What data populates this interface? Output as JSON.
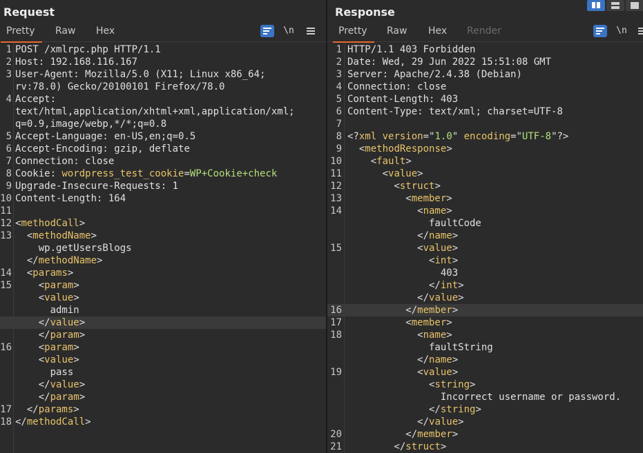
{
  "request": {
    "title": "Request",
    "tabs": [
      {
        "label": "Pretty",
        "active": true
      },
      {
        "label": "Raw",
        "active": false
      },
      {
        "label": "Hex",
        "active": false
      }
    ],
    "newline_label": "\\n",
    "lines": [
      {
        "n": "1",
        "segs": [
          {
            "t": "POST /xmlrpc.php HTTP/1.1",
            "c": "plain"
          }
        ]
      },
      {
        "n": "2",
        "segs": [
          {
            "t": "Host: ",
            "c": "plain"
          },
          {
            "t": "192.168.116.167",
            "c": "text"
          }
        ]
      },
      {
        "n": "3",
        "segs": [
          {
            "t": "User-Agent: ",
            "c": "plain"
          },
          {
            "t": "Mozilla/5.0 (X11; Linux x86_64;",
            "c": "text"
          }
        ]
      },
      {
        "n": "",
        "segs": [
          {
            "t": "rv:78.0) Gecko/20100101 Firefox/78.0",
            "c": "text"
          }
        ]
      },
      {
        "n": "4",
        "segs": [
          {
            "t": "Accept:",
            "c": "plain"
          }
        ]
      },
      {
        "n": "",
        "segs": [
          {
            "t": "text/html,application/xhtml+xml,application/xml;",
            "c": "text"
          }
        ]
      },
      {
        "n": "",
        "segs": [
          {
            "t": "q=0.9,image/webp,*/*;q=0.8",
            "c": "text"
          }
        ]
      },
      {
        "n": "5",
        "segs": [
          {
            "t": "Accept-Language: ",
            "c": "plain"
          },
          {
            "t": "en-US,en;q=0.5",
            "c": "text"
          }
        ]
      },
      {
        "n": "6",
        "segs": [
          {
            "t": "Accept-Encoding: ",
            "c": "plain"
          },
          {
            "t": "gzip, deflate",
            "c": "text"
          }
        ]
      },
      {
        "n": "7",
        "segs": [
          {
            "t": "Connection: ",
            "c": "plain"
          },
          {
            "t": "close",
            "c": "text"
          }
        ]
      },
      {
        "n": "8",
        "segs": [
          {
            "t": "Cookie: ",
            "c": "plain"
          },
          {
            "t": "wordpress_test_cookie",
            "c": "tag"
          },
          {
            "t": "=",
            "c": "plain"
          },
          {
            "t": "WP+Cookie+check",
            "c": "val"
          }
        ]
      },
      {
        "n": "9",
        "segs": [
          {
            "t": "Upgrade-Insecure-Requests: ",
            "c": "plain"
          },
          {
            "t": "1",
            "c": "text"
          }
        ]
      },
      {
        "n": "10",
        "segs": [
          {
            "t": "Content-Length: ",
            "c": "plain"
          },
          {
            "t": "164",
            "c": "text"
          }
        ]
      },
      {
        "n": "11",
        "segs": []
      },
      {
        "n": "12",
        "segs": [
          {
            "t": "<",
            "c": "br"
          },
          {
            "t": "methodCall",
            "c": "tag"
          },
          {
            "t": ">",
            "c": "br"
          }
        ]
      },
      {
        "n": "13",
        "segs": [
          {
            "t": "  <",
            "c": "br"
          },
          {
            "t": "methodName",
            "c": "tag"
          },
          {
            "t": ">",
            "c": "br"
          }
        ]
      },
      {
        "n": "",
        "segs": [
          {
            "t": "    wp.getUsersBlogs",
            "c": "text"
          }
        ]
      },
      {
        "n": "",
        "segs": [
          {
            "t": "  </",
            "c": "br"
          },
          {
            "t": "methodName",
            "c": "tag"
          },
          {
            "t": ">",
            "c": "br"
          }
        ]
      },
      {
        "n": "14",
        "segs": [
          {
            "t": "  <",
            "c": "br"
          },
          {
            "t": "params",
            "c": "tag"
          },
          {
            "t": ">",
            "c": "br"
          }
        ]
      },
      {
        "n": "15",
        "segs": [
          {
            "t": "    <",
            "c": "br"
          },
          {
            "t": "param",
            "c": "tag"
          },
          {
            "t": ">",
            "c": "br"
          }
        ]
      },
      {
        "n": "",
        "segs": [
          {
            "t": "    <",
            "c": "br"
          },
          {
            "t": "value",
            "c": "tag"
          },
          {
            "t": ">",
            "c": "br"
          }
        ]
      },
      {
        "n": "",
        "segs": [
          {
            "t": "      admin",
            "c": "text"
          }
        ]
      },
      {
        "n": "",
        "hl": true,
        "segs": [
          {
            "t": "    </",
            "c": "br"
          },
          {
            "t": "value",
            "c": "tag"
          },
          {
            "t": ">",
            "c": "br"
          }
        ]
      },
      {
        "n": "",
        "segs": [
          {
            "t": "    </",
            "c": "br"
          },
          {
            "t": "param",
            "c": "tag"
          },
          {
            "t": ">",
            "c": "br"
          }
        ]
      },
      {
        "n": "16",
        "segs": [
          {
            "t": "    <",
            "c": "br"
          },
          {
            "t": "param",
            "c": "tag"
          },
          {
            "t": ">",
            "c": "br"
          }
        ]
      },
      {
        "n": "",
        "segs": [
          {
            "t": "    <",
            "c": "br"
          },
          {
            "t": "value",
            "c": "tag"
          },
          {
            "t": ">",
            "c": "br"
          }
        ]
      },
      {
        "n": "",
        "segs": [
          {
            "t": "      pass",
            "c": "text"
          }
        ]
      },
      {
        "n": "",
        "segs": [
          {
            "t": "    </",
            "c": "br"
          },
          {
            "t": "value",
            "c": "tag"
          },
          {
            "t": ">",
            "c": "br"
          }
        ]
      },
      {
        "n": "",
        "segs": [
          {
            "t": "    </",
            "c": "br"
          },
          {
            "t": "param",
            "c": "tag"
          },
          {
            "t": ">",
            "c": "br"
          }
        ]
      },
      {
        "n": "17",
        "segs": [
          {
            "t": "  </",
            "c": "br"
          },
          {
            "t": "params",
            "c": "tag"
          },
          {
            "t": ">",
            "c": "br"
          }
        ]
      },
      {
        "n": "18",
        "segs": [
          {
            "t": "</",
            "c": "br"
          },
          {
            "t": "methodCall",
            "c": "tag"
          },
          {
            "t": ">",
            "c": "br"
          }
        ]
      }
    ]
  },
  "response": {
    "title": "Response",
    "tabs": [
      {
        "label": "Pretty",
        "active": true
      },
      {
        "label": "Raw",
        "active": false
      },
      {
        "label": "Hex",
        "active": false
      },
      {
        "label": "Render",
        "active": false,
        "disabled": true
      }
    ],
    "newline_label": "\\n",
    "lines": [
      {
        "n": "1",
        "segs": [
          {
            "t": "HTTP/1.1 403 Forbidden",
            "c": "plain"
          }
        ]
      },
      {
        "n": "2",
        "segs": [
          {
            "t": "Date: ",
            "c": "plain"
          },
          {
            "t": "Wed, 29 Jun 2022 15:51:08 GMT",
            "c": "text"
          }
        ]
      },
      {
        "n": "3",
        "segs": [
          {
            "t": "Server: ",
            "c": "plain"
          },
          {
            "t": "Apache/2.4.38 (Debian)",
            "c": "text"
          }
        ]
      },
      {
        "n": "4",
        "segs": [
          {
            "t": "Connection: ",
            "c": "plain"
          },
          {
            "t": "close",
            "c": "text"
          }
        ]
      },
      {
        "n": "5",
        "segs": [
          {
            "t": "Content-Length: ",
            "c": "plain"
          },
          {
            "t": "403",
            "c": "text"
          }
        ]
      },
      {
        "n": "6",
        "segs": [
          {
            "t": "Content-Type: ",
            "c": "plain"
          },
          {
            "t": "text/xml; charset=UTF-8",
            "c": "text"
          }
        ]
      },
      {
        "n": "7",
        "segs": []
      },
      {
        "n": "8",
        "segs": [
          {
            "t": "<?",
            "c": "br"
          },
          {
            "t": "xml",
            "c": "tag"
          },
          {
            "t": " ",
            "c": "br"
          },
          {
            "t": "version",
            "c": "tag"
          },
          {
            "t": "=\"",
            "c": "br"
          },
          {
            "t": "1.0",
            "c": "val"
          },
          {
            "t": "\" ",
            "c": "br"
          },
          {
            "t": "encoding",
            "c": "tag"
          },
          {
            "t": "=\"",
            "c": "br"
          },
          {
            "t": "UTF-8",
            "c": "val"
          },
          {
            "t": "\"?>",
            "c": "br"
          }
        ]
      },
      {
        "n": "9",
        "segs": [
          {
            "t": "  <",
            "c": "br"
          },
          {
            "t": "methodResponse",
            "c": "tag"
          },
          {
            "t": ">",
            "c": "br"
          }
        ]
      },
      {
        "n": "10",
        "segs": [
          {
            "t": "    <",
            "c": "br"
          },
          {
            "t": "fault",
            "c": "tag"
          },
          {
            "t": ">",
            "c": "br"
          }
        ]
      },
      {
        "n": "11",
        "segs": [
          {
            "t": "      <",
            "c": "br"
          },
          {
            "t": "value",
            "c": "tag"
          },
          {
            "t": ">",
            "c": "br"
          }
        ]
      },
      {
        "n": "12",
        "segs": [
          {
            "t": "        <",
            "c": "br"
          },
          {
            "t": "struct",
            "c": "tag"
          },
          {
            "t": ">",
            "c": "br"
          }
        ]
      },
      {
        "n": "13",
        "segs": [
          {
            "t": "          <",
            "c": "br"
          },
          {
            "t": "member",
            "c": "tag"
          },
          {
            "t": ">",
            "c": "br"
          }
        ]
      },
      {
        "n": "14",
        "segs": [
          {
            "t": "            <",
            "c": "br"
          },
          {
            "t": "name",
            "c": "tag"
          },
          {
            "t": ">",
            "c": "br"
          }
        ]
      },
      {
        "n": "",
        "segs": [
          {
            "t": "              faultCode",
            "c": "text"
          }
        ]
      },
      {
        "n": "",
        "segs": [
          {
            "t": "            </",
            "c": "br"
          },
          {
            "t": "name",
            "c": "tag"
          },
          {
            "t": ">",
            "c": "br"
          }
        ]
      },
      {
        "n": "15",
        "segs": [
          {
            "t": "            <",
            "c": "br"
          },
          {
            "t": "value",
            "c": "tag"
          },
          {
            "t": ">",
            "c": "br"
          }
        ]
      },
      {
        "n": "",
        "segs": [
          {
            "t": "              <",
            "c": "br"
          },
          {
            "t": "int",
            "c": "tag"
          },
          {
            "t": ">",
            "c": "br"
          }
        ]
      },
      {
        "n": "",
        "segs": [
          {
            "t": "                403",
            "c": "text"
          }
        ]
      },
      {
        "n": "",
        "segs": [
          {
            "t": "              </",
            "c": "br"
          },
          {
            "t": "int",
            "c": "tag"
          },
          {
            "t": ">",
            "c": "br"
          }
        ]
      },
      {
        "n": "",
        "segs": [
          {
            "t": "            </",
            "c": "br"
          },
          {
            "t": "value",
            "c": "tag"
          },
          {
            "t": ">",
            "c": "br"
          }
        ]
      },
      {
        "n": "16",
        "hl": true,
        "segs": [
          {
            "t": "          </",
            "c": "br"
          },
          {
            "t": "member",
            "c": "tag"
          },
          {
            "t": ">",
            "c": "br"
          }
        ]
      },
      {
        "n": "17",
        "segs": [
          {
            "t": "          <",
            "c": "br"
          },
          {
            "t": "member",
            "c": "tag"
          },
          {
            "t": ">",
            "c": "br"
          }
        ]
      },
      {
        "n": "18",
        "segs": [
          {
            "t": "            <",
            "c": "br"
          },
          {
            "t": "name",
            "c": "tag"
          },
          {
            "t": ">",
            "c": "br"
          }
        ]
      },
      {
        "n": "",
        "segs": [
          {
            "t": "              faultString",
            "c": "text"
          }
        ]
      },
      {
        "n": "",
        "segs": [
          {
            "t": "            </",
            "c": "br"
          },
          {
            "t": "name",
            "c": "tag"
          },
          {
            "t": ">",
            "c": "br"
          }
        ]
      },
      {
        "n": "19",
        "segs": [
          {
            "t": "            <",
            "c": "br"
          },
          {
            "t": "value",
            "c": "tag"
          },
          {
            "t": ">",
            "c": "br"
          }
        ]
      },
      {
        "n": "",
        "segs": [
          {
            "t": "              <",
            "c": "br"
          },
          {
            "t": "string",
            "c": "tag"
          },
          {
            "t": ">",
            "c": "br"
          }
        ]
      },
      {
        "n": "",
        "segs": [
          {
            "t": "                Incorrect username or password.",
            "c": "text"
          }
        ]
      },
      {
        "n": "",
        "segs": [
          {
            "t": "              </",
            "c": "br"
          },
          {
            "t": "string",
            "c": "tag"
          },
          {
            "t": ">",
            "c": "br"
          }
        ]
      },
      {
        "n": "",
        "segs": [
          {
            "t": "            </",
            "c": "br"
          },
          {
            "t": "value",
            "c": "tag"
          },
          {
            "t": ">",
            "c": "br"
          }
        ]
      },
      {
        "n": "20",
        "segs": [
          {
            "t": "          </",
            "c": "br"
          },
          {
            "t": "member",
            "c": "tag"
          },
          {
            "t": ">",
            "c": "br"
          }
        ]
      },
      {
        "n": "21",
        "segs": [
          {
            "t": "        </",
            "c": "br"
          },
          {
            "t": "struct",
            "c": "tag"
          },
          {
            "t": ">",
            "c": "br"
          }
        ]
      }
    ]
  },
  "colors": {
    "accent_tab_underline": "#e8692f",
    "wrap_button": "#3a74c4",
    "xml_tag": "#e8c36a",
    "attr_value": "#b4e07a"
  },
  "icons": {
    "wrap": "wrap-lines-icon",
    "newline": "show-newlines-icon",
    "menu": "hamburger-menu-icon",
    "layout": [
      "layout-columns-icon",
      "layout-rows-icon",
      "layout-tabs-icon"
    ]
  }
}
